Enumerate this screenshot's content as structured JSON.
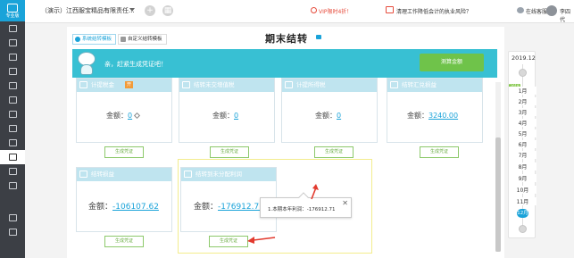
{
  "brand": {
    "name": "专业版"
  },
  "topbar": {
    "company": "（演示）江西服宝精品有限责任...",
    "vip": "VIP限时4折！",
    "risk": "清理工作降低会计的执业风险？",
    "online": "在线客服",
    "user": "李四代"
  },
  "panel": {
    "tabs": [
      "系统结转模板",
      "自定义结转模板"
    ],
    "title": "期末结转",
    "banner_msg": "亲，赶紧生成凭证吧！",
    "calc_button": "测算金额",
    "amount_label": "金额：",
    "generate_label": "生成凭证",
    "cards": [
      {
        "title": "计提税金",
        "badge": "开",
        "value": "0"
      },
      {
        "title": "结转未交增值税",
        "value": "0"
      },
      {
        "title": "计提所得税",
        "value": "0"
      },
      {
        "title": "结转汇兑损益",
        "value": "3240.00"
      },
      {
        "title": "结转损益",
        "value": "-106107.62"
      },
      {
        "title": "结转到未分配利润",
        "value": "-176912.71"
      }
    ],
    "popup": {
      "text": "1.本期本年利润：-176912.71",
      "close": "✕"
    }
  },
  "timeline": {
    "year": "2019.12",
    "marker": "2019",
    "months": [
      "1月",
      "2月",
      "3月",
      "4月",
      "5月",
      "6月",
      "7月",
      "8月",
      "9月",
      "10月",
      "11月",
      "12月"
    ],
    "current": "12月"
  },
  "colors": {
    "accent": "#1aa3d9",
    "banner": "#38c0d3",
    "card_head": "#bfe4ef",
    "button_green": "#6fc34a",
    "arrow_red": "#e23a2e"
  },
  "icons": [
    "home-icon",
    "plus-icon",
    "grid-icon",
    "crown-icon",
    "risk-icon",
    "service-icon",
    "edit-icon",
    "close-icon"
  ]
}
